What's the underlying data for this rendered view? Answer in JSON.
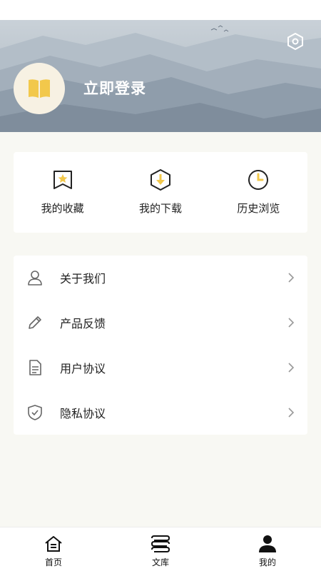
{
  "header": {
    "login_label": "立即登录"
  },
  "quick_actions": [
    {
      "label": "我的收藏",
      "icon": "bookmark-star-icon"
    },
    {
      "label": "我的下载",
      "icon": "download-icon"
    },
    {
      "label": "历史浏览",
      "icon": "clock-icon"
    }
  ],
  "menu": [
    {
      "label": "关于我们",
      "icon": "user-icon"
    },
    {
      "label": "产品反馈",
      "icon": "pencil-icon"
    },
    {
      "label": "用户协议",
      "icon": "document-icon"
    },
    {
      "label": "隐私协议",
      "icon": "shield-check-icon"
    }
  ],
  "tabbar": [
    {
      "label": "首页",
      "icon": "home-icon"
    },
    {
      "label": "文库",
      "icon": "library-icon"
    },
    {
      "label": "我的",
      "icon": "profile-icon"
    }
  ],
  "colors": {
    "accent": "#f2c84b",
    "page_bg": "#f8f8f3",
    "card_bg": "#ffffff",
    "text": "#222222"
  }
}
